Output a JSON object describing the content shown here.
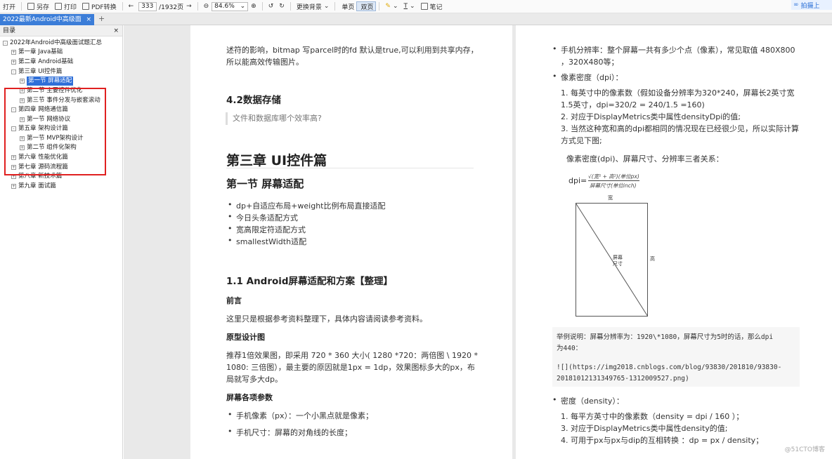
{
  "toolbar": {
    "open": "打开",
    "save_as": "另存",
    "print": "打印",
    "pdf_convert": "PDF转换",
    "page_current": "333",
    "page_total": "/1932页",
    "zoom": "84.6%",
    "background": "更换背景",
    "single_page": "单页",
    "double_page": "双页",
    "notes": "笔记",
    "right_label": "拍摄上"
  },
  "tab": {
    "title": "2022最新Android中高级面试题",
    "close": "×",
    "add": "+"
  },
  "sidebar": {
    "title": "目录",
    "close": "×",
    "items": [
      {
        "label": "2022年Android中高级面试题汇总",
        "level": 0,
        "toggle": "-"
      },
      {
        "label": "第一章 Java基础",
        "level": 1,
        "toggle": "+"
      },
      {
        "label": "第二章 Android基础",
        "level": 1,
        "toggle": "+"
      },
      {
        "label": "第三章 UI控件篇",
        "level": 1,
        "toggle": "-"
      },
      {
        "label": "第一节 屏幕适配",
        "level": 2,
        "toggle": "+",
        "selected": true
      },
      {
        "label": "第二节 主要控件优化",
        "level": 2,
        "toggle": "+"
      },
      {
        "label": "第三节 事件分发与嵌套滚动",
        "level": 2,
        "toggle": "+"
      },
      {
        "label": "第四章 网络通信篇",
        "level": 1,
        "toggle": "-"
      },
      {
        "label": "第一节 网络协议",
        "level": 2,
        "toggle": "+"
      },
      {
        "label": "第五章 架构设计篇",
        "level": 1,
        "toggle": "-"
      },
      {
        "label": "第一节 MVP架构设计",
        "level": 2,
        "toggle": "+"
      },
      {
        "label": "第二节 组件化架构",
        "level": 2,
        "toggle": "+"
      },
      {
        "label": "第六章 性能优化篇",
        "level": 1,
        "toggle": "+"
      },
      {
        "label": "第七章 源码流程篇",
        "level": 1,
        "toggle": "+"
      },
      {
        "label": "第八章 新技术篇",
        "level": 1,
        "toggle": "+"
      },
      {
        "label": "第九章 面试篇",
        "level": 1,
        "toggle": "+"
      }
    ]
  },
  "left_page": {
    "intro_1": "述符的影响，bitmap 写parcel时的fd 默认是true,可以利用到共享内存，",
    "intro_2": "所以能高效传输图片。",
    "h_storage": "4.2数据存储",
    "quote": "文件和数据库哪个效率高?",
    "h_chapter": "第三章 UI控件篇",
    "h_section": "第一节 屏幕适配",
    "bullets": [
      "dp+自适应布局+weight比例布局直接适配",
      "今日头条适配方式",
      "宽高限定符适配方式",
      "smallestWidth适配"
    ],
    "h_sub": "1.1 Android屏幕适配和方案【整理】",
    "preface_title": "前言",
    "preface_text": "这里只是根据参考资料整理下，具体内容请阅读参考资料。",
    "proto_title": "原型设计图",
    "proto_1": "推荐1倍效果图，即采用 720 * 360 大小( 1280 *720：两倍图 \\ 1920 *",
    "proto_2": "1080: 三倍图），最主要的原因就是1px = 1dp，效果图标多大的px，布",
    "proto_3": "局就写多大dp。",
    "params_title": "屏幕各项参数",
    "param_bullets": [
      "手机像素（px）：一个小黑点就是像素；",
      "手机尺寸：屏幕的对角线的长度；"
    ]
  },
  "right_page": {
    "res_1": "手机分辨率：整个屏幕一共有多少个点（像素），常见取值 480X800",
    "res_2": "，320X480等；",
    "density_title": "像素密度（dpi）：",
    "d1a": "1. 每英寸中的像素数（假如设备分辨率为320*240，屏幕长2英寸宽",
    "d1b": "1.5英寸，dpi=320/2 = 240/1.5 =160)",
    "d2": "2. 对应于DisplayMetrics类中属性densityDpi的值;",
    "d3a": "3. 当然这种宽和高的dpi都相同的情况现在已经很少见，所以实际计算",
    "d3b": "方式见下图;",
    "relation": "像素密度(dpi)、屏幕尺寸、分辨率三者关系：",
    "formula_lhs": "dpi=",
    "formula_num": "√(宽² + 高²)(单位px)",
    "formula_den": "屏幕尺寸(单位inch)",
    "diagram_width": "宽",
    "diagram_height": "高",
    "diagram_center_1": "屏幕",
    "diagram_center_2": "尺寸",
    "code_1": "举例说明：屏幕分辨率为：1920\\*1080，屏幕尺寸为5时的话，那么dpi",
    "code_2": "为440：",
    "code_3": "![](https://img2018.cnblogs.com/blog/93830/201810/93830-",
    "code_4": "20181012131349765-1312009527.png)",
    "density2_title": "密度（density）：",
    "e1": "1. 每平方英寸中的像素数（density = dpi / 160 ）；",
    "e2": "3. 对应于DisplayMetrics类中属性density的值;",
    "e3": "4. 可用于px与px与dip的互相转换 ：dp = px / density；",
    "watermark": "@51CTO博客"
  },
  "colors": {
    "accent": "#2f6fd8",
    "highlight_box": "#e02020",
    "tab": "#3b7dd8"
  }
}
